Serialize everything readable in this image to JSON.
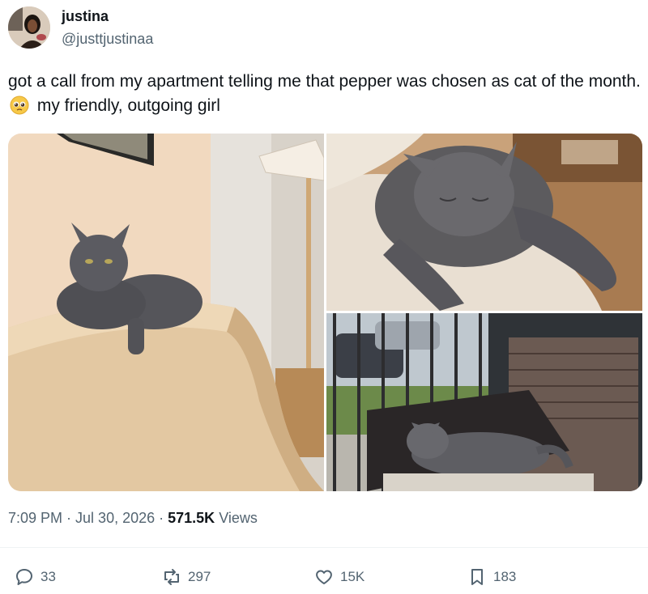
{
  "author": {
    "display_name": "justina",
    "handle": "@justtjustinaa"
  },
  "tweet": {
    "text_before_emoji": "got a call from my apartment telling me that pepper was chosen as cat of the month.",
    "emoji": "pleading-face",
    "text_after_emoji": "my friendly, outgoing girl"
  },
  "media": {
    "photos": [
      {
        "subject": "gray cat lying on beige sofa cushion"
      },
      {
        "subject": "gray cat sleeping on fluffy blanket"
      },
      {
        "subject": "gray cat resting on wicker patio chair"
      }
    ]
  },
  "meta": {
    "time": "7:09 PM",
    "separator": " · ",
    "date": "Jul 30, 2026",
    "views_count": "571.5K",
    "views_label": "Views"
  },
  "actions": {
    "replies": "33",
    "reposts": "297",
    "likes": "15K",
    "bookmarks": "183"
  },
  "colors": {
    "text_primary": "#0f1419",
    "text_secondary": "#536471",
    "divider": "#eff3f4"
  }
}
